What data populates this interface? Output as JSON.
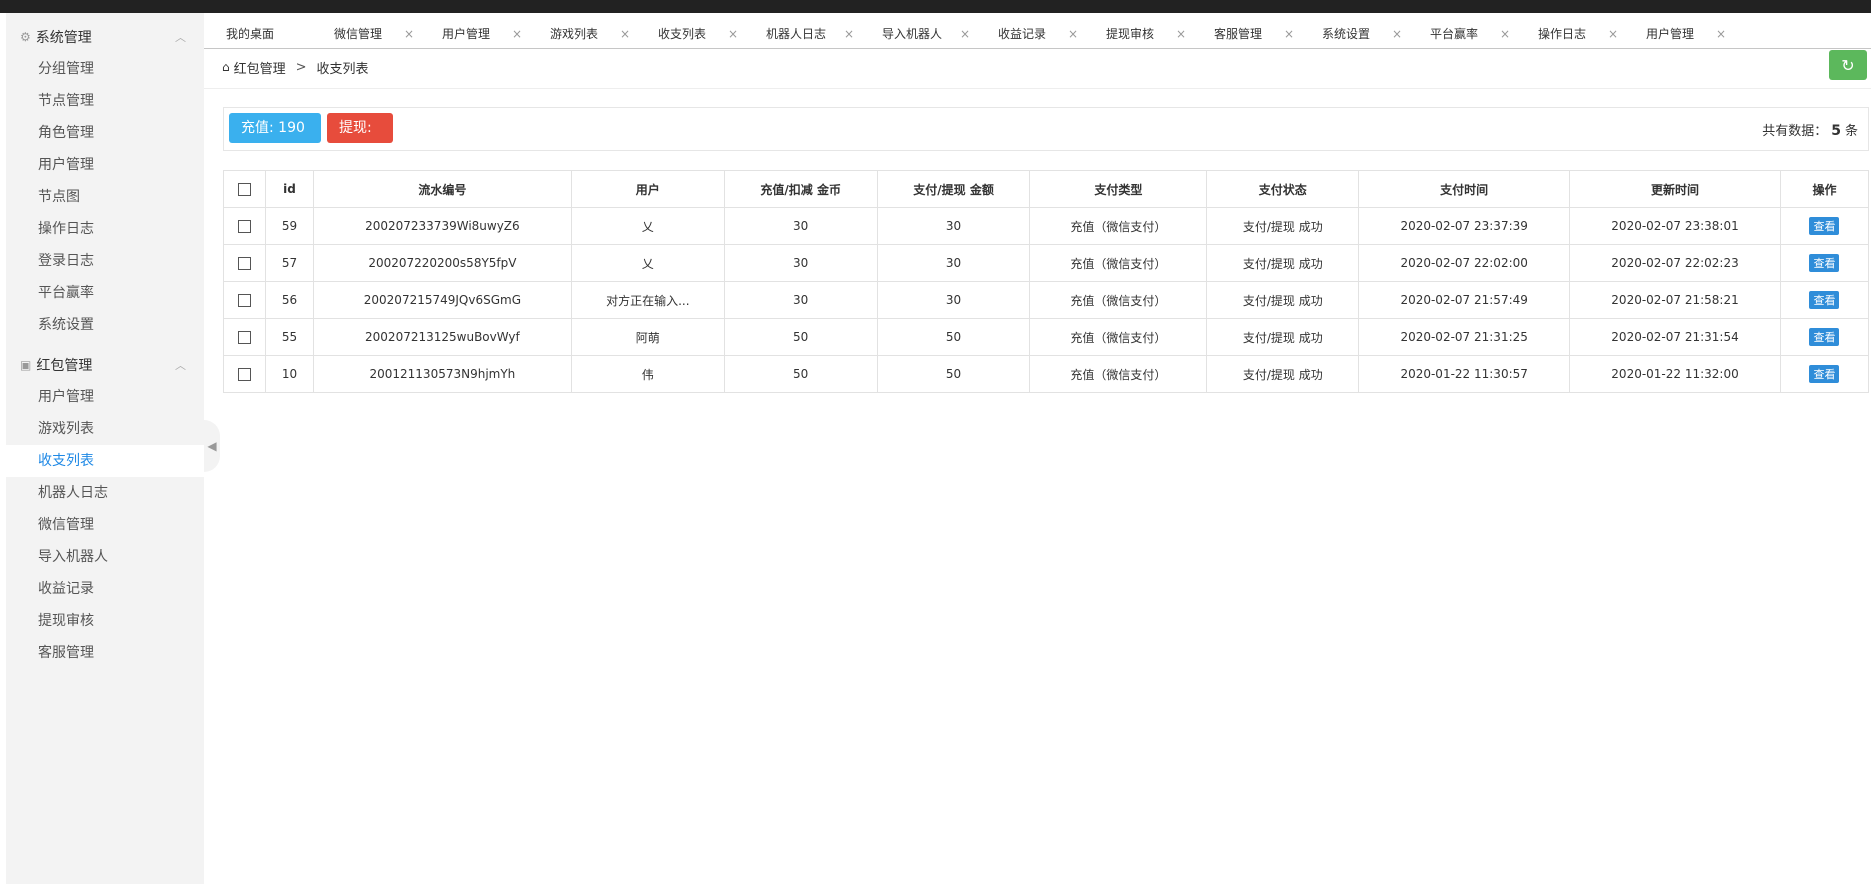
{
  "sidebar": {
    "groups": [
      {
        "icon": "gear-icon",
        "title": "系统管理",
        "items": [
          "分组管理",
          "节点管理",
          "角色管理",
          "用户管理",
          "节点图",
          "操作日志",
          "登录日志",
          "平台赢率",
          "系统设置"
        ]
      },
      {
        "icon": "redpacket-icon",
        "title": "红包管理",
        "items": [
          "用户管理",
          "游戏列表",
          "收支列表",
          "机器人日志",
          "微信管理",
          "导入机器人",
          "收益记录",
          "提现审核",
          "客服管理"
        ]
      }
    ],
    "active_item": "收支列表"
  },
  "tabs": [
    "我的桌面",
    "微信管理",
    "用户管理",
    "游戏列表",
    "收支列表",
    "机器人日志",
    "导入机器人",
    "收益记录",
    "提现审核",
    "客服管理",
    "系统设置",
    "平台赢率",
    "操作日志",
    "用户管理"
  ],
  "active_tab_index": 4,
  "breadcrumb": {
    "root": "红包管理",
    "sep": ">",
    "current": "收支列表"
  },
  "stats": {
    "recharge_label": "充值: 190",
    "withdraw_label": "提现:",
    "total_prefix": "共有数据：",
    "total_count": "5",
    "total_suffix": "条"
  },
  "table": {
    "headers": [
      "id",
      "流水编号",
      "用户",
      "充值/扣减 金币",
      "支付/提现 金额",
      "支付类型",
      "支付状态",
      "支付时间",
      "更新时间",
      "操作"
    ],
    "rows": [
      [
        "59",
        "200207233739Wi8uwyZ6",
        "乂",
        "30",
        "30",
        "充值（微信支付）",
        "支付/提现 成功",
        "2020-02-07 23:37:39",
        "2020-02-07 23:38:01",
        "查看"
      ],
      [
        "57",
        "200207220200s58Y5fpV",
        "乂",
        "30",
        "30",
        "充值（微信支付）",
        "支付/提现 成功",
        "2020-02-07 22:02:00",
        "2020-02-07 22:02:23",
        "查看"
      ],
      [
        "56",
        "200207215749JQv6SGmG",
        "对方正在输入...",
        "30",
        "30",
        "充值（微信支付）",
        "支付/提现 成功",
        "2020-02-07 21:57:49",
        "2020-02-07 21:58:21",
        "查看"
      ],
      [
        "55",
        "200207213125wuBovWyf",
        "阿萌",
        "50",
        "50",
        "充值（微信支付）",
        "支付/提现 成功",
        "2020-02-07 21:31:25",
        "2020-02-07 21:31:54",
        "查看"
      ],
      [
        "10",
        "200121130573N9hjmYh",
        "伟",
        "50",
        "50",
        "充值（微信支付）",
        "支付/提现 成功",
        "2020-01-22 11:30:57",
        "2020-01-22 11:32:00",
        "查看"
      ]
    ]
  }
}
